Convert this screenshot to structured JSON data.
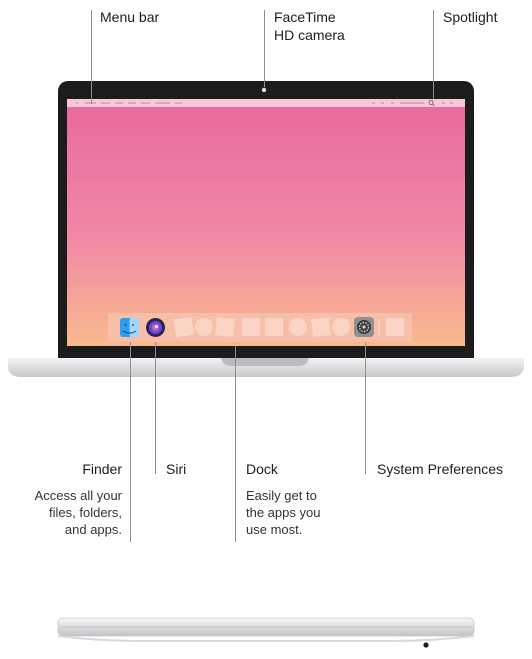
{
  "callouts": {
    "menu_bar": "Menu bar",
    "facetime_line1": "FaceTime",
    "facetime_line2": "HD camera",
    "spotlight": "Spotlight",
    "finder": "Finder",
    "siri": "Siri",
    "dock": "Dock",
    "system_preferences": "System Preferences"
  },
  "descriptions": {
    "finder_lines": [
      "Access all your",
      "files, folders,",
      "and apps."
    ],
    "dock_lines": [
      "Easily get to",
      "the apps you",
      "use most."
    ]
  },
  "colors": {
    "wallpaper_top": "#e8699f",
    "wallpaper_bottom": "#f9b98d",
    "bezel": "#1c1c1e",
    "chassis": "#e3e3e6",
    "leader_line": "#8e8e8e"
  },
  "icons": [
    "finder-icon",
    "siri-icon",
    "system-preferences-icon",
    "camera-dot",
    "spotlight-search-icon"
  ]
}
